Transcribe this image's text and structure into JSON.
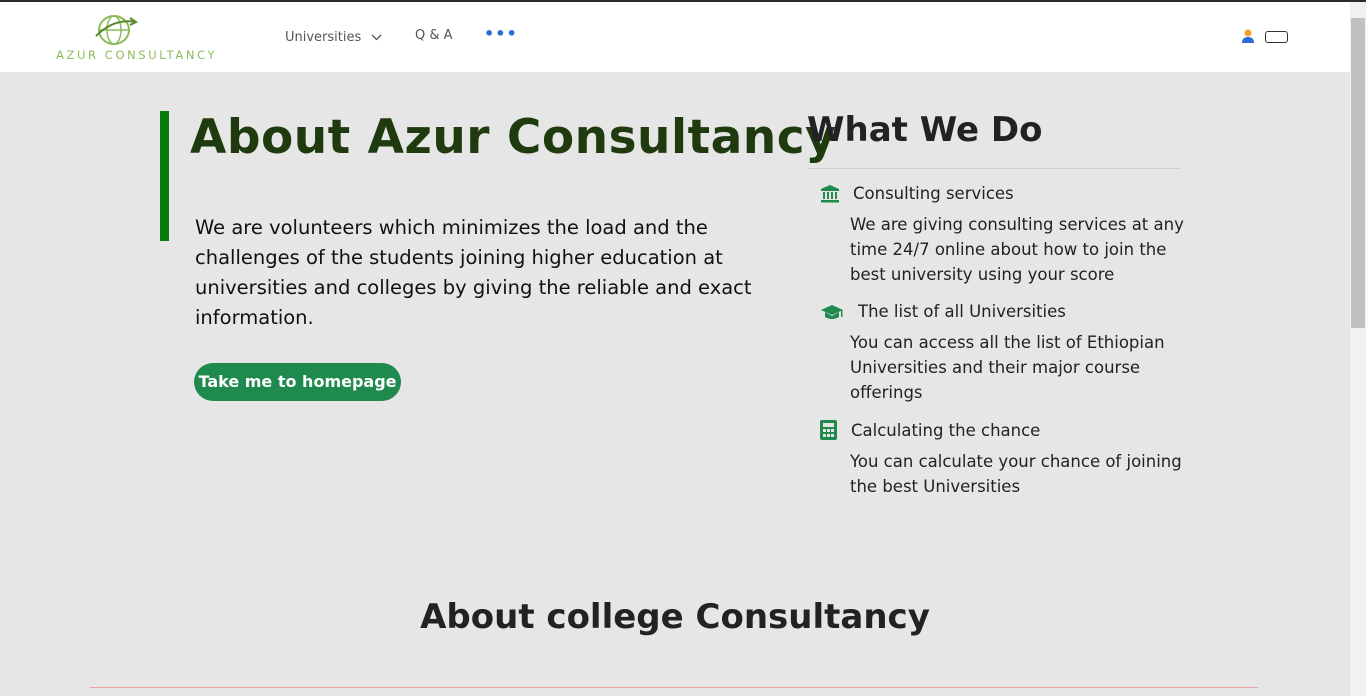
{
  "header": {
    "logo_text": "AZUR CONSULTANCY",
    "nav": {
      "universities": "Universities",
      "qa": "Q & A",
      "more": "•••"
    }
  },
  "about": {
    "title": "About Azur Consultancy",
    "paragraph": "We are volunteers which minimizes the load and the challenges of the students joining higher education at universities and colleges by giving the reliable and exact information.",
    "button": "Take me to homepage"
  },
  "what_we_do": {
    "title": "What We Do",
    "services": [
      {
        "icon": "bank-icon",
        "title": "Consulting services",
        "desc": "We are giving consulting services at any time 24/7 online about how to join the best university using your score"
      },
      {
        "icon": "graduation-cap-icon",
        "title": "The list of all Universities",
        "desc": "You can access all the list of Ethiopian Universities and their major course offerings"
      },
      {
        "icon": "calculator-icon",
        "title": "Calculating the chance",
        "desc": "You can calculate your chance of joining the best Universities"
      }
    ]
  },
  "college": {
    "title": "About college Consultancy"
  },
  "colors": {
    "accent": "#0a7a0a",
    "button": "#1e8a4e",
    "icon": "#1e8a4e",
    "title_dark_green": "#1e3a0e",
    "logo": "#8dbb5a"
  }
}
